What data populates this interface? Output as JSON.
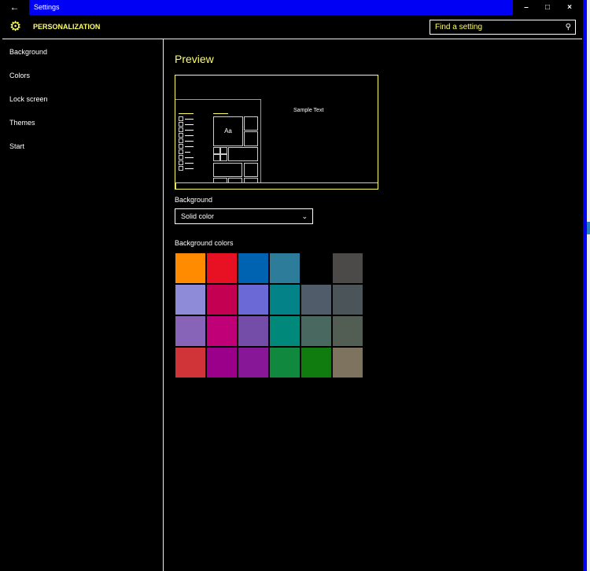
{
  "window": {
    "title": "Settings",
    "back_icon": "back-arrow-icon",
    "controls": [
      "minimize",
      "maximize",
      "close"
    ]
  },
  "header": {
    "title": "PERSONALIZATION",
    "icon": "gear-icon",
    "search_placeholder": "Find a setting"
  },
  "sidebar": {
    "items": [
      {
        "label": "Background"
      },
      {
        "label": "Colors"
      },
      {
        "label": "Lock screen"
      },
      {
        "label": "Themes"
      },
      {
        "label": "Start"
      }
    ]
  },
  "main": {
    "preview_title": "Preview",
    "preview": {
      "sample_text": "Sample Text",
      "tile_text": "Aa"
    },
    "background_label": "Background",
    "background_value": "Solid color",
    "colors_label": "Background colors",
    "colors": [
      [
        "#ff8c00",
        "#e81123",
        "#0063b1",
        "#2d7d9a",
        "#000000",
        "#4c4a48"
      ],
      [
        "#8e8cd8",
        "#c30052",
        "#6b69d6",
        "#038387",
        "#515c6b",
        "#4a5459"
      ],
      [
        "#8764b8",
        "#bf0077",
        "#744da9",
        "#00887a",
        "#486860",
        "#525e54"
      ],
      [
        "#d13438",
        "#9a0089",
        "#881798",
        "#10893e",
        "#107c10",
        "#7e735f"
      ]
    ]
  },
  "colors": {
    "accent": "#ffff66",
    "titlebar": "#0000f5"
  }
}
